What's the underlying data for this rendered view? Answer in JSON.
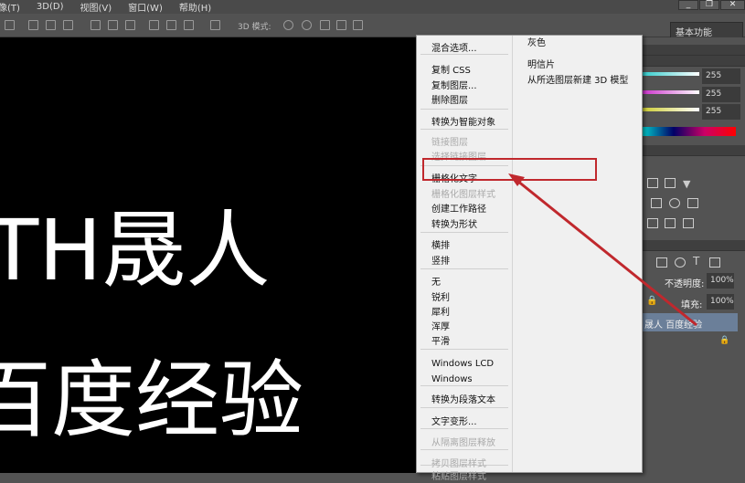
{
  "menubar": {
    "items": [
      "图像(T)",
      "3D(D)",
      "视图(V)",
      "窗口(W)",
      "帮助(H)"
    ]
  },
  "optbar": {
    "mode_3d_label": "3D 模式:",
    "workspace": "基本功能"
  },
  "window": {
    "minimize": "_",
    "restore": "❐",
    "close": "✕"
  },
  "canvas": {
    "line1": "TH晟人",
    "line2": "百度经验"
  },
  "color_panel": {
    "values": [
      "255",
      "255",
      "255"
    ]
  },
  "layers_panel": {
    "opacity_label": "不透明度:",
    "opacity": "100%",
    "fill_label": "填充:",
    "fill": "100%",
    "layer_name": "晟人 百度经验"
  },
  "context_menu": {
    "left": [
      {
        "label": "混合选项...",
        "disabled": false
      },
      {
        "label": "复制 CSS",
        "disabled": false
      },
      {
        "label": "复制图层...",
        "disabled": false
      },
      {
        "label": "删除图层",
        "disabled": false
      },
      {
        "label": "转换为智能对象",
        "disabled": false
      },
      {
        "label": "链接图层",
        "disabled": true
      },
      {
        "label": "选择链接图层",
        "disabled": true
      },
      {
        "label": "栅格化文字",
        "disabled": false
      },
      {
        "label": "栅格化图层样式",
        "disabled": true
      },
      {
        "label": "创建工作路径",
        "disabled": false
      },
      {
        "label": "转换为形状",
        "disabled": false
      },
      {
        "label": "横排",
        "disabled": false
      },
      {
        "label": "竖排",
        "disabled": false
      },
      {
        "label": "无",
        "disabled": false
      },
      {
        "label": "锐利",
        "disabled": false
      },
      {
        "label": "犀利",
        "disabled": false
      },
      {
        "label": "浑厚",
        "disabled": false
      },
      {
        "label": "平滑",
        "disabled": false
      },
      {
        "label": "Windows LCD",
        "disabled": false
      },
      {
        "label": "Windows",
        "disabled": false
      },
      {
        "label": "转换为段落文本",
        "disabled": false
      },
      {
        "label": "文字变形...",
        "disabled": false
      },
      {
        "label": "从隔离图层释放",
        "disabled": true
      },
      {
        "label": "拷贝图层样式",
        "disabled": true
      },
      {
        "label": "粘贴图层样式",
        "disabled": true
      }
    ],
    "right": [
      {
        "label": "灰色"
      },
      {
        "label": "明信片"
      },
      {
        "label": "从所选图层新建 3D 模型"
      }
    ],
    "highlighted": "栅格化文字"
  },
  "colors": {
    "annotation": "#c0282d",
    "menu_bg": "#f0f0f0",
    "canvas": "#000000"
  }
}
